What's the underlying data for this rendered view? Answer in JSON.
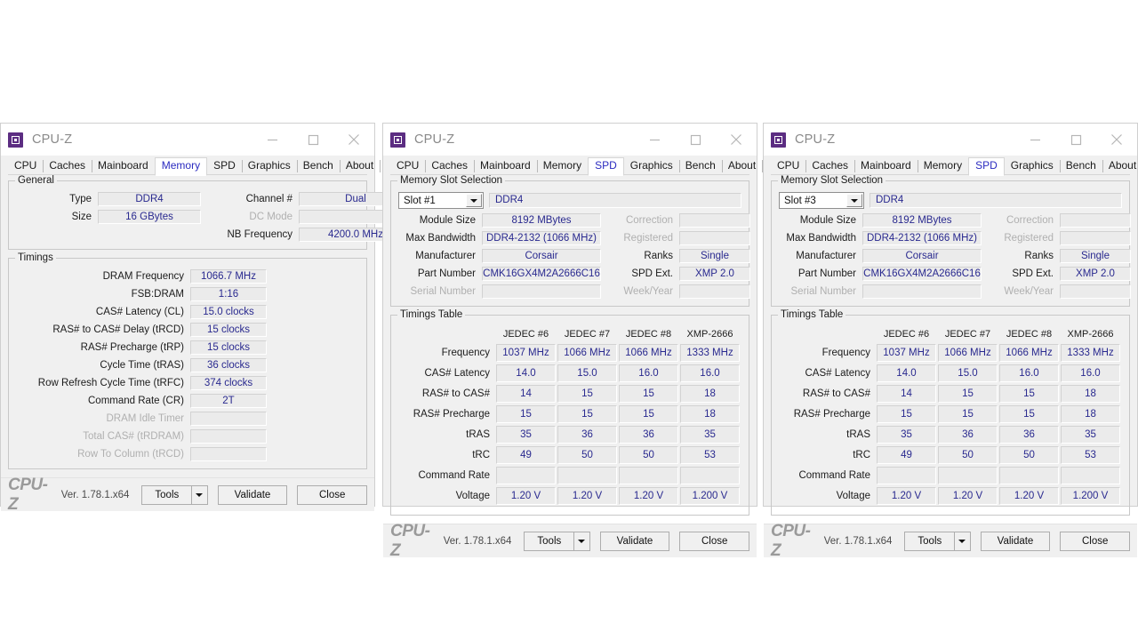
{
  "app": {
    "title": "CPU-Z",
    "brand": "CPU-Z",
    "version": "Ver. 1.78.1.x64",
    "icon": "cpu-chip-icon"
  },
  "window_controls": {
    "minimize": "minimize-icon",
    "maximize": "maximize-icon",
    "close": "close-icon"
  },
  "tabs": [
    {
      "label": "CPU"
    },
    {
      "label": "Caches"
    },
    {
      "label": "Mainboard"
    },
    {
      "label": "Memory"
    },
    {
      "label": "SPD"
    },
    {
      "label": "Graphics"
    },
    {
      "label": "Bench"
    },
    {
      "label": "About"
    }
  ],
  "statusbar": {
    "tools_label": "Tools",
    "tools_arrow": "chevron-down-icon",
    "validate_label": "Validate",
    "close_label": "Close"
  },
  "window1": {
    "active_tab": "Memory",
    "general": {
      "legend": "General",
      "type_label": "Type",
      "type_value": "DDR4",
      "size_label": "Size",
      "size_value": "16 GBytes",
      "channel_label": "Channel #",
      "channel_value": "Dual",
      "dcmode_label": "DC Mode",
      "dcmode_value": "",
      "nbfreq_label": "NB Frequency",
      "nbfreq_value": "4200.0 MHz"
    },
    "timings": {
      "legend": "Timings",
      "rows": [
        {
          "label": "DRAM Frequency",
          "value": "1066.7 MHz",
          "disabled": false
        },
        {
          "label": "FSB:DRAM",
          "value": "1:16",
          "disabled": false
        },
        {
          "label": "CAS# Latency (CL)",
          "value": "15.0 clocks",
          "disabled": false
        },
        {
          "label": "RAS# to CAS# Delay (tRCD)",
          "value": "15 clocks",
          "disabled": false
        },
        {
          "label": "RAS# Precharge (tRP)",
          "value": "15 clocks",
          "disabled": false
        },
        {
          "label": "Cycle Time (tRAS)",
          "value": "36 clocks",
          "disabled": false
        },
        {
          "label": "Row Refresh Cycle Time (tRFC)",
          "value": "374 clocks",
          "disabled": false
        },
        {
          "label": "Command Rate (CR)",
          "value": "2T",
          "disabled": false
        },
        {
          "label": "DRAM Idle Timer",
          "value": "",
          "disabled": true
        },
        {
          "label": "Total CAS# (tRDRAM)",
          "value": "",
          "disabled": true
        },
        {
          "label": "Row To Column (tRCD)",
          "value": "",
          "disabled": true
        }
      ]
    }
  },
  "window2": {
    "active_tab": "SPD",
    "slot_selection": {
      "legend": "Memory Slot Selection",
      "slot_value": "Slot #1",
      "memory_type": "DDR4",
      "left_rows": [
        {
          "label": "Module Size",
          "value": "8192 MBytes",
          "disabled": false
        },
        {
          "label": "Max Bandwidth",
          "value": "DDR4-2132 (1066 MHz)",
          "disabled": false
        },
        {
          "label": "Manufacturer",
          "value": "Corsair",
          "disabled": false
        },
        {
          "label": "Part Number",
          "value": "CMK16GX4M2A2666C16",
          "disabled": false
        },
        {
          "label": "Serial Number",
          "value": "",
          "disabled": true
        }
      ],
      "right_rows": [
        {
          "label": "Correction",
          "value": "",
          "disabled": true
        },
        {
          "label": "Registered",
          "value": "",
          "disabled": true
        },
        {
          "label": "Ranks",
          "value": "Single",
          "disabled": false
        },
        {
          "label": "SPD Ext.",
          "value": "XMP 2.0",
          "disabled": false
        },
        {
          "label": "Week/Year",
          "value": "",
          "disabled": true
        }
      ]
    },
    "timings_table": {
      "legend": "Timings Table",
      "columns": [
        "JEDEC #6",
        "JEDEC #7",
        "JEDEC #8",
        "XMP-2666"
      ],
      "rows": [
        {
          "label": "Frequency",
          "values": [
            "1037 MHz",
            "1066 MHz",
            "1066 MHz",
            "1333 MHz"
          ]
        },
        {
          "label": "CAS# Latency",
          "values": [
            "14.0",
            "15.0",
            "16.0",
            "16.0"
          ]
        },
        {
          "label": "RAS# to CAS#",
          "values": [
            "14",
            "15",
            "15",
            "18"
          ]
        },
        {
          "label": "RAS# Precharge",
          "values": [
            "15",
            "15",
            "15",
            "18"
          ]
        },
        {
          "label": "tRAS",
          "values": [
            "35",
            "36",
            "36",
            "35"
          ]
        },
        {
          "label": "tRC",
          "values": [
            "49",
            "50",
            "50",
            "53"
          ]
        },
        {
          "label": "Command Rate",
          "values": [
            "",
            "",
            "",
            ""
          ]
        },
        {
          "label": "Voltage",
          "values": [
            "1.20 V",
            "1.20 V",
            "1.20 V",
            "1.200 V"
          ]
        }
      ]
    }
  },
  "window3": {
    "active_tab": "SPD",
    "slot_selection": {
      "legend": "Memory Slot Selection",
      "slot_value": "Slot #3",
      "memory_type": "DDR4",
      "left_rows": [
        {
          "label": "Module Size",
          "value": "8192 MBytes",
          "disabled": false
        },
        {
          "label": "Max Bandwidth",
          "value": "DDR4-2132 (1066 MHz)",
          "disabled": false
        },
        {
          "label": "Manufacturer",
          "value": "Corsair",
          "disabled": false
        },
        {
          "label": "Part Number",
          "value": "CMK16GX4M2A2666C16",
          "disabled": false
        },
        {
          "label": "Serial Number",
          "value": "",
          "disabled": true
        }
      ],
      "right_rows": [
        {
          "label": "Correction",
          "value": "",
          "disabled": true
        },
        {
          "label": "Registered",
          "value": "",
          "disabled": true
        },
        {
          "label": "Ranks",
          "value": "Single",
          "disabled": false
        },
        {
          "label": "SPD Ext.",
          "value": "XMP 2.0",
          "disabled": false
        },
        {
          "label": "Week/Year",
          "value": "",
          "disabled": true
        }
      ]
    },
    "timings_table": {
      "legend": "Timings Table",
      "columns": [
        "JEDEC #6",
        "JEDEC #7",
        "JEDEC #8",
        "XMP-2666"
      ],
      "rows": [
        {
          "label": "Frequency",
          "values": [
            "1037 MHz",
            "1066 MHz",
            "1066 MHz",
            "1333 MHz"
          ]
        },
        {
          "label": "CAS# Latency",
          "values": [
            "14.0",
            "15.0",
            "16.0",
            "16.0"
          ]
        },
        {
          "label": "RAS# to CAS#",
          "values": [
            "14",
            "15",
            "15",
            "18"
          ]
        },
        {
          "label": "RAS# Precharge",
          "values": [
            "15",
            "15",
            "15",
            "18"
          ]
        },
        {
          "label": "tRAS",
          "values": [
            "35",
            "36",
            "36",
            "35"
          ]
        },
        {
          "label": "tRC",
          "values": [
            "49",
            "50",
            "50",
            "53"
          ]
        },
        {
          "label": "Command Rate",
          "values": [
            "",
            "",
            "",
            ""
          ]
        },
        {
          "label": "Voltage",
          "values": [
            "1.20 V",
            "1.20 V",
            "1.20 V",
            "1.200 V"
          ]
        }
      ]
    }
  },
  "colors": {
    "value_text": "#29298f",
    "active_tab_text": "#2b2bc0",
    "icon_purple": "#5c2d82",
    "field_bg": "#ebebeb",
    "window_bg": "#f0f0f0",
    "disabled_text": "#b0b0b0"
  }
}
